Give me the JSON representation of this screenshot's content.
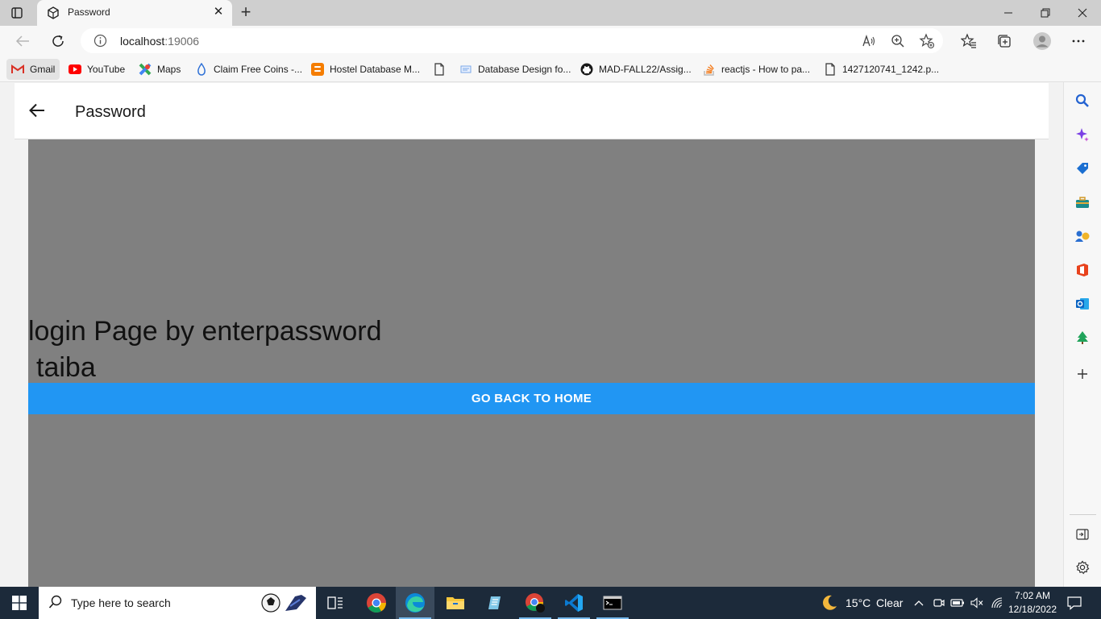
{
  "browser": {
    "tab": {
      "title": "Password",
      "favicon": "app-cube-icon"
    },
    "address": {
      "host": "localhost",
      "port": ":19006"
    },
    "window_controls": [
      "minimize-icon",
      "restore-icon",
      "close-icon"
    ]
  },
  "bookmarks": [
    {
      "label": "Gmail",
      "icon": "gmail-icon"
    },
    {
      "label": "YouTube",
      "icon": "youtube-icon"
    },
    {
      "label": "Maps",
      "icon": "maps-icon"
    },
    {
      "label": "Claim Free Coins -...",
      "icon": "droplet-icon"
    },
    {
      "label": "Hostel Database M...",
      "icon": "blogger-icon"
    },
    {
      "label": "",
      "icon": "page-icon"
    },
    {
      "label": "Database Design fo...",
      "icon": "doc-icon"
    },
    {
      "label": "MAD-FALL22/Assig...",
      "icon": "github-icon"
    },
    {
      "label": "reactjs - How to pa...",
      "icon": "stackoverflow-icon"
    },
    {
      "label": "1427120741_1242.p...",
      "icon": "page-icon"
    }
  ],
  "app": {
    "header_title": "Password",
    "headline": "login Page by enterpassword",
    "username": "taiba",
    "home_button": "GO BACK TO HOME"
  },
  "sidebar_icons": [
    "search-icon",
    "sparkle-icon",
    "tag-icon",
    "toolbox-icon",
    "games-icon",
    "office-icon",
    "outlook-icon",
    "tree-icon",
    "add-icon",
    "layout-icon",
    "settings-icon"
  ],
  "taskbar": {
    "search_placeholder": "Type here to search",
    "apps": [
      "task-view-icon",
      "chrome-icon",
      "edge-icon",
      "file-explorer-icon",
      "notepad-icon",
      "chrome-profile-icon",
      "vscode-icon",
      "terminal-icon"
    ],
    "weather": {
      "temp": "15°C",
      "condition": "Clear"
    },
    "time": "7:02 AM",
    "date": "12/18/2022"
  },
  "colors": {
    "accent_button": "#2196f3",
    "screen_background": "#808080",
    "taskbar": "#1c2a3a"
  }
}
